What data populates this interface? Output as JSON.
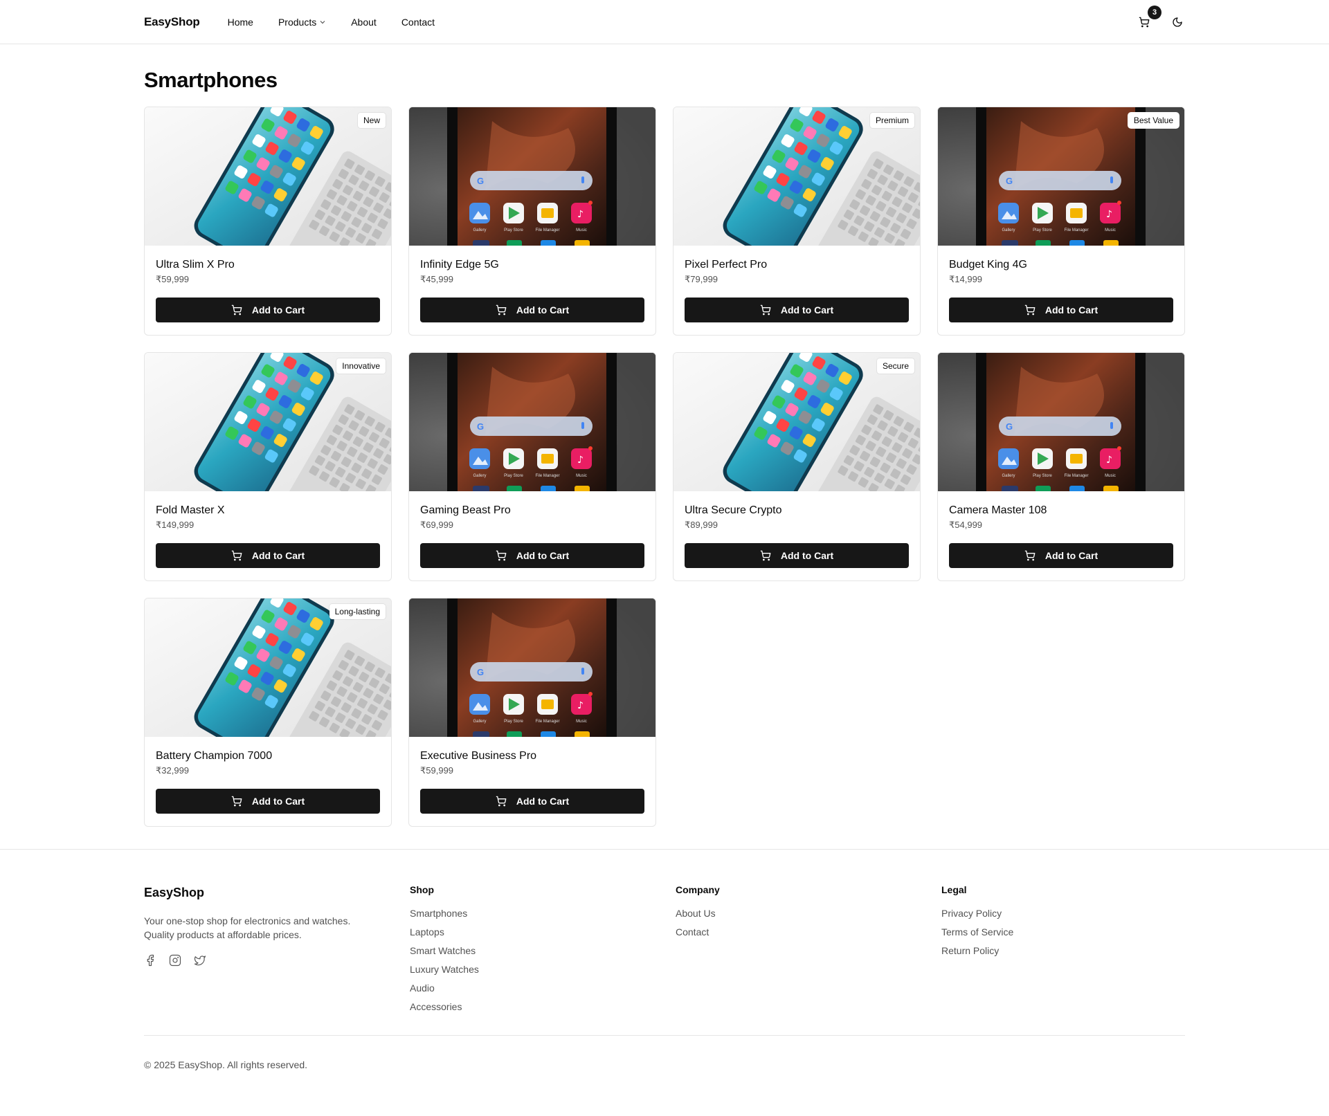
{
  "header": {
    "logo": "EasyShop",
    "nav": [
      "Home",
      "Products",
      "About",
      "Contact"
    ],
    "cart_count": "3"
  },
  "page_title": "Smartphones",
  "products": [
    {
      "name": "Ultra Slim X Pro",
      "price": "₹59,999",
      "tag": "New",
      "image": "light",
      "button": "Add to Cart"
    },
    {
      "name": "Infinity Edge 5G",
      "price": "₹45,999",
      "tag": "",
      "image": "dark",
      "button": "Add to Cart"
    },
    {
      "name": "Pixel Perfect Pro",
      "price": "₹79,999",
      "tag": "Premium",
      "image": "light",
      "button": "Add to Cart"
    },
    {
      "name": "Budget King 4G",
      "price": "₹14,999",
      "tag": "Best Value",
      "image": "dark",
      "button": "Add to Cart"
    },
    {
      "name": "Fold Master X",
      "price": "₹149,999",
      "tag": "Innovative",
      "image": "light",
      "button": "Add to Cart"
    },
    {
      "name": "Gaming Beast Pro",
      "price": "₹69,999",
      "tag": "",
      "image": "dark",
      "button": "Add to Cart"
    },
    {
      "name": "Ultra Secure Crypto",
      "price": "₹89,999",
      "tag": "Secure",
      "image": "light",
      "button": "Add to Cart"
    },
    {
      "name": "Camera Master 108",
      "price": "₹54,999",
      "tag": "",
      "image": "dark",
      "button": "Add to Cart"
    },
    {
      "name": "Battery Champion 7000",
      "price": "₹32,999",
      "tag": "Long-lasting",
      "image": "light",
      "button": "Add to Cart"
    },
    {
      "name": "Executive Business Pro",
      "price": "₹59,999",
      "tag": "",
      "image": "dark",
      "button": "Add to Cart"
    }
  ],
  "phone_screen_labels": {
    "gallery": "Gallery",
    "play_store": "Play Store",
    "file_manager": "File Manager",
    "music": "Music"
  },
  "footer": {
    "logo": "EasyShop",
    "description": "Your one-stop shop for electronics and watches. Quality products at affordable prices.",
    "columns": [
      {
        "title": "Shop",
        "links": [
          "Smartphones",
          "Laptops",
          "Smart Watches",
          "Luxury Watches",
          "Audio",
          "Accessories"
        ]
      },
      {
        "title": "Company",
        "links": [
          "About Us",
          "Contact"
        ]
      },
      {
        "title": "Legal",
        "links": [
          "Privacy Policy",
          "Terms of Service",
          "Return Policy"
        ]
      }
    ],
    "social_icons": [
      "facebook-icon",
      "instagram-icon",
      "twitter-icon"
    ],
    "copyright": "© 2025 EasyShop. All rights reserved."
  }
}
